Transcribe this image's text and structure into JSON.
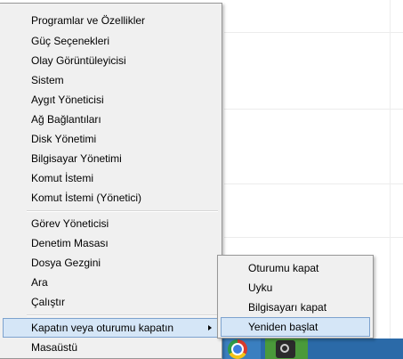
{
  "menu": {
    "group1": [
      "Programlar ve Özellikler",
      "Güç Seçenekleri",
      "Olay Görüntüleyicisi",
      "Sistem",
      "Aygıt Yöneticisi",
      "Ağ Bağlantıları",
      "Disk Yönetimi",
      "Bilgisayar Yönetimi",
      "Komut İstemi",
      "Komut İstemi (Yönetici)"
    ],
    "group2": [
      "Görev Yöneticisi",
      "Denetim Masası",
      "Dosya Gezgini",
      "Ara",
      "Çalıştır"
    ],
    "shutdown": "Kapatın veya oturumu kapatın",
    "desktop": "Masaüstü"
  },
  "submenu": {
    "items": [
      "Oturumu kapat",
      "Uyku",
      "Bilgisayarı kapat",
      "Yeniden başlat"
    ],
    "highlighted_index": 3
  },
  "colors": {
    "menu_background": "#f0f0f0",
    "highlight_background": "#d5e6f7",
    "highlight_border": "#7da2ce",
    "menu_border": "#979797",
    "taskbar": "#2b6aa8"
  },
  "icons": {
    "submenu_arrow": "chevron-right-icon",
    "taskbar_app_1": "chrome-icon",
    "taskbar_app_2": "steam-icon"
  }
}
